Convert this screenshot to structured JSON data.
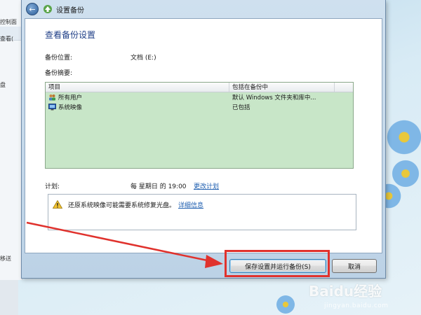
{
  "background": {
    "fragments": [
      "控制面",
      "查看(",
      "盘",
      "移送"
    ]
  },
  "window": {
    "title": "设置备份",
    "heading": "查看备份设置",
    "backup_location_label": "备份位置:",
    "backup_location_value": "文档 (E:)",
    "backup_summary_label": "备份摘要:",
    "table": {
      "headers": [
        "项目",
        "包括在备份中"
      ],
      "rows": [
        {
          "item": "所有用户",
          "included": "默认 Windows 文件夹和库中...",
          "icon": "users-icon"
        },
        {
          "item": "系统映像",
          "included": "已包括",
          "icon": "system-image-icon"
        }
      ]
    },
    "schedule_label": "计划:",
    "schedule_value": "每 星期日 的 19:00",
    "change_schedule_link": "更改计划",
    "info_text": "还原系统映像可能需要系统修复光盘。",
    "info_link": "详细信息",
    "save_run_button": "保存设置并运行备份(S)",
    "cancel_button": "取消"
  },
  "watermark": {
    "brand": "Baidu经验",
    "url": "jingyan.baidu.com"
  },
  "colors": {
    "highlight": "#e0322d",
    "list_bg": "#c8e6c8",
    "heading": "#1f3f87",
    "link": "#1f5fb0"
  }
}
